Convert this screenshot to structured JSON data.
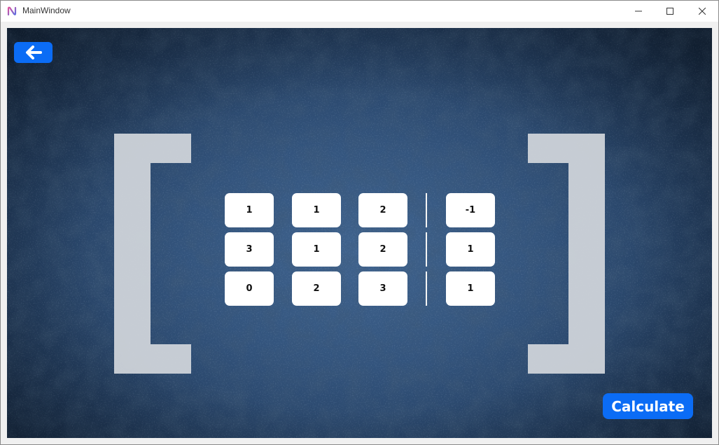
{
  "window": {
    "title": "MainWindow",
    "app_icon": "app-logo-icon",
    "controls": [
      "minimize-icon",
      "maximize-icon",
      "close-icon"
    ]
  },
  "toolbar": {
    "back_icon": "arrow-left-icon"
  },
  "matrix": {
    "coefficients": [
      [
        "1",
        "1",
        "2"
      ],
      [
        "3",
        "1",
        "2"
      ],
      [
        "0",
        "2",
        "3"
      ]
    ],
    "constants": [
      "-1",
      "1",
      "1"
    ]
  },
  "actions": {
    "calculate_label": "Calculate"
  },
  "colors": {
    "accent": "#0b6cf5",
    "background": "#33547d",
    "bracket": "#d2d6dc",
    "cell": "#ffffff"
  }
}
